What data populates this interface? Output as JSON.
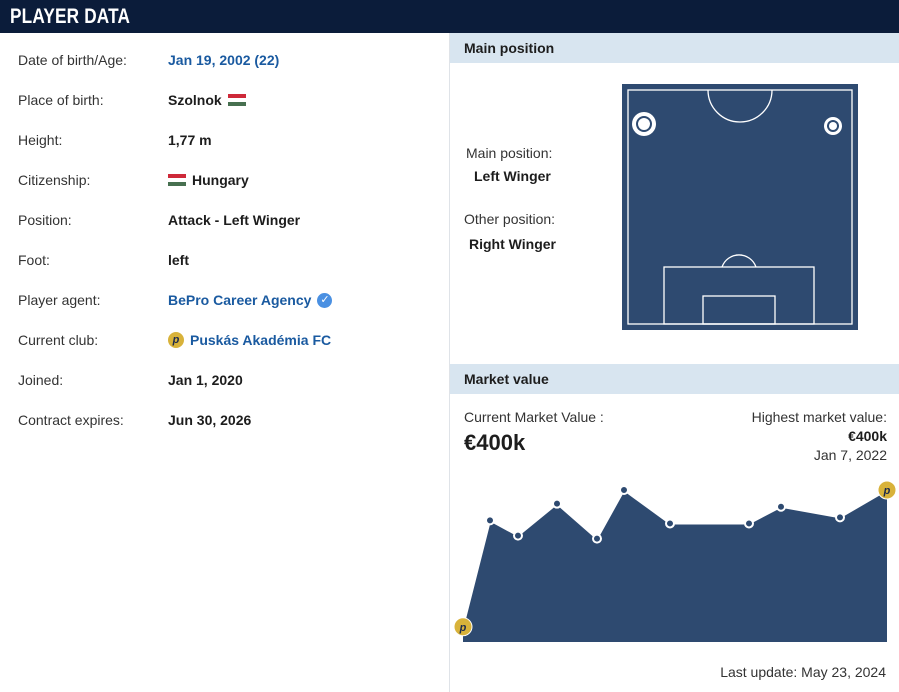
{
  "header": {
    "title": "PLAYER DATA"
  },
  "details": [
    {
      "label": "Date of birth/Age:",
      "value": "Jan 19, 2002 (22)",
      "style": "link"
    },
    {
      "label": "Place of birth:",
      "value": "Szolnok",
      "flag": "hungary-flag"
    },
    {
      "label": "Height:",
      "value": "1,77 m"
    },
    {
      "label": "Citizenship:",
      "value": "Hungary",
      "flag_before": "hungary-flag"
    },
    {
      "label": "Position:",
      "value": "Attack - Left Winger"
    },
    {
      "label": "Foot:",
      "value": "left"
    },
    {
      "label": "Player agent:",
      "value": "BePro Career Agency",
      "style": "link",
      "icon": "verified-icon"
    },
    {
      "label": "Current club:",
      "value": "Puskás Akadémia FC",
      "style": "link",
      "icon": "club-logo-icon"
    },
    {
      "label": "Joined:",
      "value": "Jan 1, 2020"
    },
    {
      "label": "Contract expires:",
      "value": "Jun 30, 2026"
    }
  ],
  "position": {
    "heading": "Main position",
    "main_label": "Main position:",
    "main_value": "Left Winger",
    "other_label": "Other position:",
    "other_value": "Right Winger"
  },
  "market": {
    "heading": "Market value",
    "current_label": "Current Market Value :",
    "current_value": "€400k",
    "highest_label": "Highest market value:",
    "highest_value": "€400k",
    "highest_date": "Jan 7, 2022",
    "last_update": "Last update: May 23, 2024",
    "chart_points": [
      0.1,
      0.8,
      0.7,
      0.91,
      0.68,
      1.0,
      0.78,
      0.78,
      0.89,
      0.82,
      1.0
    ]
  },
  "colors": {
    "header_bg": "#0b1c3a",
    "link": "#1a5aa0",
    "section_bg": "#d8e5f0",
    "pitch": "#2e4a70",
    "chart_fill": "#2e4a70"
  }
}
